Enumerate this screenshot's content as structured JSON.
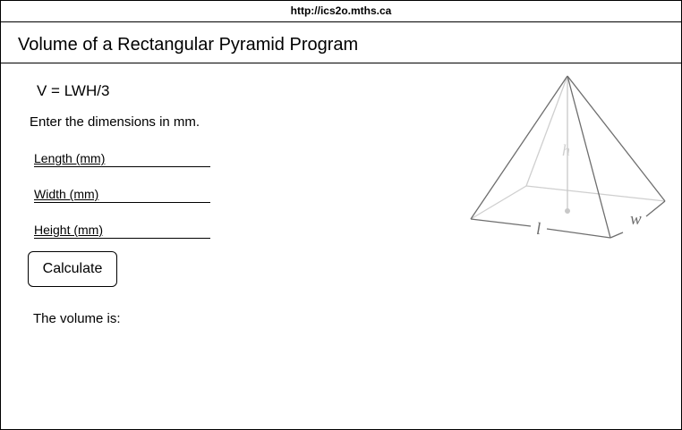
{
  "url": "http://ics2o.mths.ca",
  "page_title": "Volume of a Rectangular Pyramid Program",
  "formula": "V  = LWH/3",
  "instructions": "Enter the dimensions in mm.",
  "fields": [
    {
      "label": "Length (mm)",
      "value": ""
    },
    {
      "label": "Width (mm)",
      "value": ""
    },
    {
      "label": "Height (mm)",
      "value": ""
    }
  ],
  "calculate_label": "Calculate",
  "result_label": "The volume is:",
  "diagram": {
    "height_label": "h",
    "length_label": "l",
    "width_label": "w"
  },
  "colors": {
    "edge_front": "#6e6e6e",
    "edge_hidden": "#cfcfcf",
    "height_line": "#c8c8c8"
  }
}
